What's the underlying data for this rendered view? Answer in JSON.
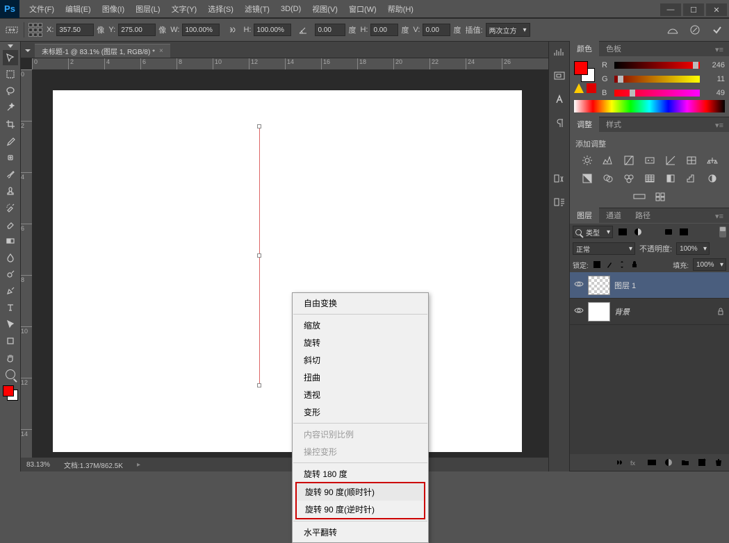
{
  "app": {
    "name": "Ps"
  },
  "menus": [
    "文件(F)",
    "编辑(E)",
    "图像(I)",
    "图层(L)",
    "文字(Y)",
    "选择(S)",
    "滤镜(T)",
    "3D(D)",
    "视图(V)",
    "窗口(W)",
    "帮助(H)"
  ],
  "options": {
    "x_label": "X:",
    "x": "357.50",
    "x_unit": "像",
    "y_label": "Y:",
    "y": "275.00",
    "y_unit": "像",
    "w_label": "W:",
    "w": "100.00%",
    "h_label": "H:",
    "h": "100.00%",
    "ang_label": "",
    "ang": "0.00",
    "ang_unit": "度",
    "hskew_label": "H:",
    "hskew": "0.00",
    "hskew_unit": "度",
    "vskew_label": "V:",
    "vskew": "0.00",
    "vskew_unit": "度",
    "interp_label": "插值:",
    "interp": "两次立方"
  },
  "document": {
    "tab": "未标题-1 @ 83.1% (图层 1, RGB/8) *"
  },
  "rulerH": [
    "0",
    "2",
    "4",
    "6",
    "8",
    "10",
    "12",
    "14",
    "16",
    "18",
    "20",
    "22",
    "24",
    "26"
  ],
  "rulerV": [
    "0",
    "2",
    "4",
    "6",
    "8",
    "10",
    "12",
    "14"
  ],
  "context": {
    "free": "自由变换",
    "scale": "缩放",
    "rotate": "旋转",
    "skew": "斜切",
    "distort": "扭曲",
    "perspective": "透视",
    "warp": "变形",
    "content_aware": "内容识别比例",
    "puppet": "操控变形",
    "rot180": "旋转 180 度",
    "rot90cw": "旋转 90 度(顺时针)",
    "rot90ccw": "旋转 90 度(逆时针)",
    "fliph": "水平翻转"
  },
  "status": {
    "zoom": "83.13%",
    "doc": "文档:1.37M/862.5K"
  },
  "panels": {
    "color": {
      "tab1": "颜色",
      "tab2": "色板",
      "r": "R",
      "g": "G",
      "b": "B",
      "rv": "246",
      "gv": "11",
      "bv": "49"
    },
    "adjust": {
      "tab1": "调整",
      "tab2": "样式",
      "label": "添加调整"
    },
    "layers": {
      "tab1": "图层",
      "tab2": "通道",
      "tab3": "路径",
      "kind": "类型",
      "blend": "正常",
      "opacity_label": "不透明度:",
      "opacity": "100%",
      "lock_label": "锁定:",
      "fill_label": "填充:",
      "fill": "100%",
      "layer1": "图层 1",
      "bg": "背景"
    }
  }
}
